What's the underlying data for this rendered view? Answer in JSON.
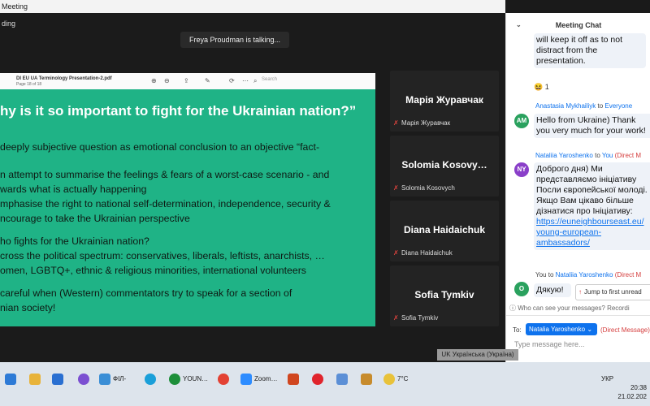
{
  "window": {
    "title": "Meeting"
  },
  "stage": {
    "recording": "ding",
    "talking": "Freya Proudman is talking..."
  },
  "pdf": {
    "filename": "DI EU UA Terminology Presentation-2.pdf",
    "page": "Page 18 of 18",
    "search_placeholder": "Search"
  },
  "slide": {
    "heading": "hy is it so important to fight for the Ukrainian nation?”",
    "lines": [
      "deeply subjective question as emotional conclusion to an objective “fact-",
      "n attempt to summarise the feelings & fears of a worst-case scenario - and",
      "wards what is actually happening",
      "mphasise the right to national self-determination, independence, security &",
      "ncourage to take the Ukrainian perspective",
      "ho fights for the Ukrainian nation?",
      "cross the political spectrum: conservatives, liberals, leftists, anarchists, …",
      "omen, LGBTQ+, ethnic & religious minorities, international volunteers",
      " careful when (Western) commentators try to speak for a section of",
      "nian society!"
    ]
  },
  "participants": [
    {
      "display": "Марія Журавчак",
      "name": "Марія Журавчак"
    },
    {
      "display": "Solomia Kosovy…",
      "name": "Solomia Kosovych"
    },
    {
      "display": "Diana Haidaichuk",
      "name": "Diana Haidaichuk"
    },
    {
      "display": "Sofia Tymkiv",
      "name": "Sofia Tymkiv"
    }
  ],
  "chat": {
    "title": "Meeting Chat",
    "msg1": {
      "lines": [
        "will keep it off as to not",
        "distract from the",
        "presentation."
      ],
      "reaction": "😆 1"
    },
    "msg2": {
      "initials": "AM",
      "sender": "Anastasia Mykhailiyk",
      "to_word": "to",
      "to": "Everyone",
      "lines": [
        "Hello from Ukraine) Thank",
        "you very much for your work!"
      ]
    },
    "msg3": {
      "initials": "NY",
      "sender": "Nataliia Yaroshenko",
      "to_word": "to",
      "to": "You",
      "direct": "(Direct M",
      "lines": [
        "Доброго дня) Ми",
        "представляємо ініціативу",
        "Посли європейської молоді.",
        "Якщо Вам цікаво більше",
        "дізнатися про Ініціативу:"
      ],
      "link_lines": [
        "https://euneighbourseast.eu/",
        "young-european-",
        "ambassadors/"
      ]
    },
    "msg4": {
      "initials": "O",
      "from": "You",
      "to_word": "to",
      "to": "Nataliia Yaroshenko",
      "direct": "(Direct M",
      "text": "Дякую!"
    },
    "jump": "Jump to first unread",
    "who_can_see": "Who can see your messages? Recordi",
    "to_label": "To:",
    "recipient": "Natalia Yaroshenko",
    "direct_message": "(Direct Message)",
    "input_placeholder": "Type message here..."
  },
  "taskbar": {
    "items": [
      "ФІЛ-",
      "YOUN…",
      "Zoom…"
    ],
    "lang_overlay": "UK Українська (Україна)",
    "temperature": "7°C",
    "lang": "УКР",
    "time": "20:38",
    "date": "21.02.202"
  },
  "colors": {
    "slide_bg": "#1fb386",
    "accent": "#0e72ed",
    "direct": "#d53e3e"
  }
}
